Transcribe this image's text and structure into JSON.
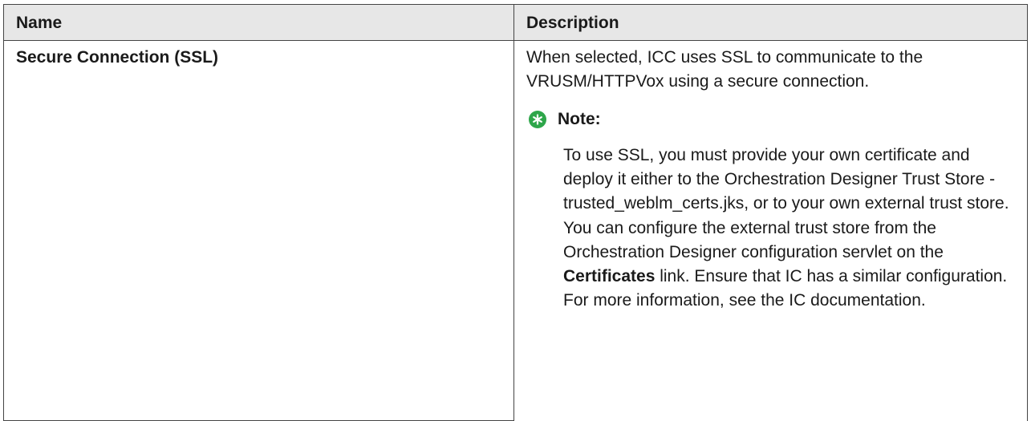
{
  "table": {
    "headers": {
      "name": "Name",
      "description": "Description"
    },
    "row": {
      "name": "Secure Connection (SSL)",
      "description": "When selected, ICC uses SSL to communicate to the VRUSM/HTTPVox using a secure connection.",
      "note": {
        "icon": "star-icon",
        "icon_color": "#2ea64a",
        "title": "Note:",
        "text_before": "To use SSL, you must provide your own certificate and deploy it either to the Orchestration Designer Trust Store - trusted_weblm_certs.jks, or to your own external trust store. You can configure the external trust store from the Orchestration Designer configuration servlet on the ",
        "link_label": "Certificates",
        "text_after": " link. Ensure that IC has a similar configuration. For more information, see the IC documentation."
      }
    }
  }
}
